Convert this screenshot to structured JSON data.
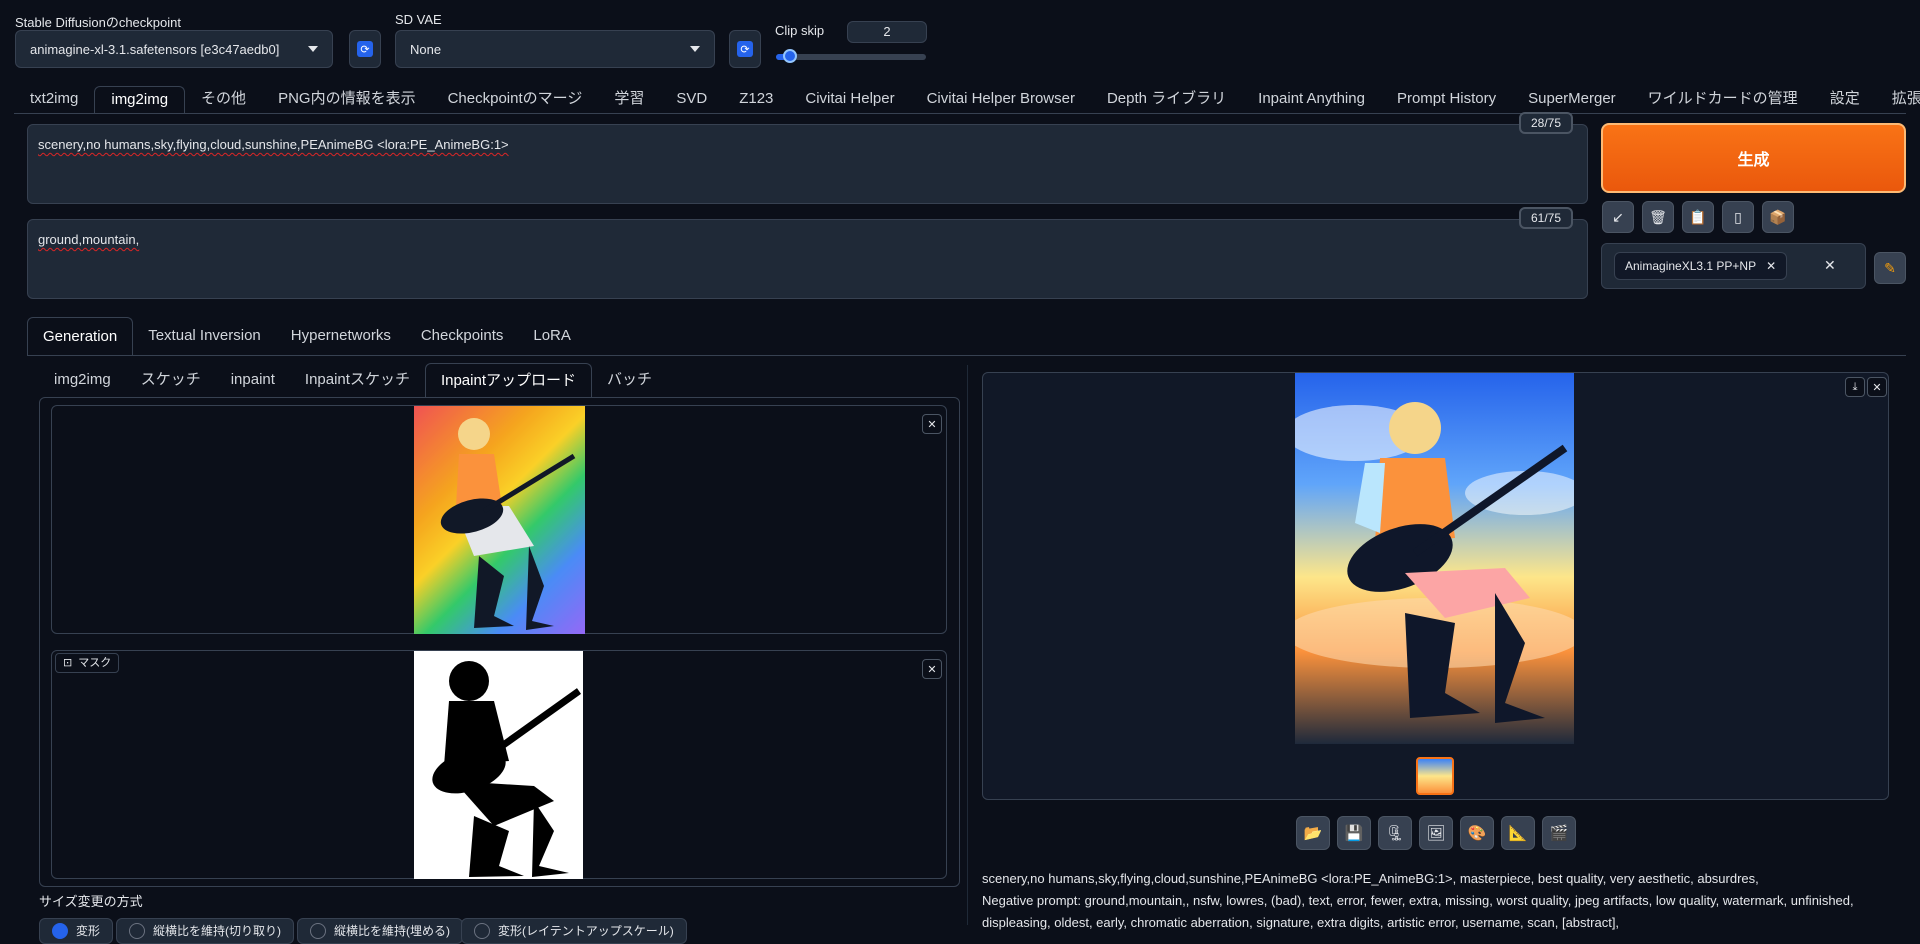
{
  "checkpoint": {
    "label": "Stable Diffusionのcheckpoint",
    "value": "animagine-xl-3.1.safetensors [e3c47aedb0]"
  },
  "vae": {
    "label": "SD VAE",
    "value": "None"
  },
  "clipskip": {
    "label": "Clip skip",
    "value": "2",
    "level": 0.09
  },
  "topnav": [
    {
      "label": "txt2img"
    },
    {
      "label": "img2img"
    },
    {
      "label": "その他"
    },
    {
      "label": "PNG内の情報を表示"
    },
    {
      "label": "Checkpointのマージ"
    },
    {
      "label": "学習"
    },
    {
      "label": "SVD"
    },
    {
      "label": "Z123"
    },
    {
      "label": "Civitai Helper"
    },
    {
      "label": "Civitai Helper Browser"
    },
    {
      "label": "Depth ライブラリ"
    },
    {
      "label": "Inpaint Anything"
    },
    {
      "label": "Prompt History"
    },
    {
      "label": "SuperMerger"
    },
    {
      "label": "ワイルドカードの管理"
    },
    {
      "label": "設定"
    },
    {
      "label": "拡張機能"
    }
  ],
  "prompt": {
    "text": "scenery,no humans,sky,flying,cloud,sunshine,PEAnimeBG <lora:PE_AnimeBG:1>",
    "counter": "28/75"
  },
  "negative": {
    "text": "ground,mountain,",
    "counter": "61/75"
  },
  "generate_label": "生成",
  "styles": {
    "chip": "AnimagineXL3.1 PP+NP"
  },
  "section_tabs": [
    {
      "label": "Generation"
    },
    {
      "label": "Textual Inversion"
    },
    {
      "label": "Hypernetworks"
    },
    {
      "label": "Checkpoints"
    },
    {
      "label": "LoRA"
    }
  ],
  "mode_tabs": [
    {
      "label": "img2img"
    },
    {
      "label": "スケッチ"
    },
    {
      "label": "inpaint"
    },
    {
      "label": "Inpaintスケッチ"
    },
    {
      "label": "Inpaintアップロード"
    },
    {
      "label": "バッチ"
    }
  ],
  "mask_label": "マスク",
  "resize": {
    "label": "サイズ変更の方式",
    "options": [
      "変形",
      "縦横比を維持(切り取り)",
      "縦横比を維持(埋める)",
      "変形(レイテントアップスケール)"
    ]
  },
  "info": {
    "line1": "scenery,no humans,sky,flying,cloud,sunshine,PEAnimeBG <lora:PE_AnimeBG:1>, masterpiece, best quality, very aesthetic, absurdres,",
    "line2": "Negative prompt: ground,mountain,, nsfw, lowres, (bad), text, error, fewer, extra, missing, worst quality, jpeg artifacts, low quality, watermark, unfinished,",
    "line3": "displeasing, oldest, early, chromatic aberration, signature, extra digits, artistic error, username, scan, [abstract],"
  },
  "colors": {
    "accent": "#f97316",
    "background": "#0b0f19",
    "panel": "#1f2937",
    "slider": "#2563eb"
  }
}
